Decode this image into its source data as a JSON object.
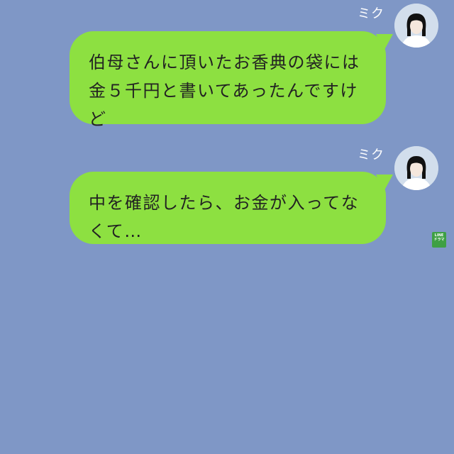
{
  "messages": [
    {
      "sender": "ミク",
      "lines": [
        "伯母さんに頂いたお香典の袋には",
        "金５千円と書いてあったんですけ",
        "ど"
      ]
    },
    {
      "sender": "ミク",
      "lines": [
        "中を確認したら、お金が入ってな",
        "くて…"
      ]
    }
  ],
  "watermark": {
    "line1": "LINE",
    "line2": "ドラマ"
  },
  "icons": [
    "avatar-icon",
    "line-drama-logo"
  ],
  "colors": {
    "background": "#7f97c6",
    "bubble": "#8de041",
    "text": "#222222",
    "name": "#ffffff"
  }
}
